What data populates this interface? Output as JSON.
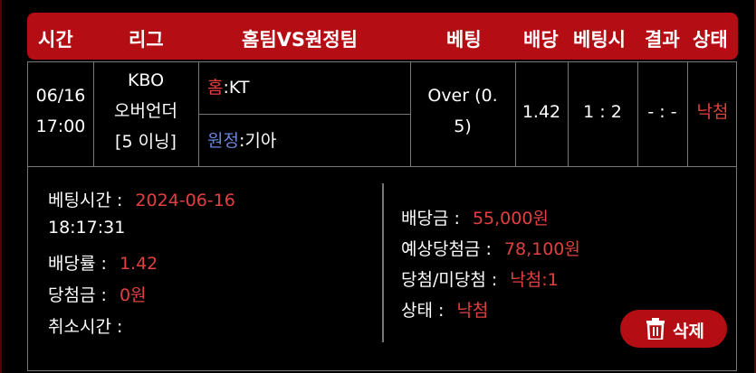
{
  "header": {
    "time": "시간",
    "league": "리그",
    "teams": "홈팀VS원정팀",
    "bet": "베팅",
    "odds": "배당",
    "bet_time": "베팅시",
    "result": "결과",
    "status": "상태"
  },
  "row": {
    "date": "06/16",
    "time": "17:00",
    "league_line1": "KBO",
    "league_line2": "오버언더",
    "league_line3": "[5 이닝]",
    "home_label": "홈",
    "home_team": ":KT",
    "away_label": "원정",
    "away_team": ":기아",
    "bet_line1": "Over (0.",
    "bet_line2": "5)",
    "odds": "1.42",
    "bet_score": "1 : 2",
    "result": "- : -",
    "status": "낙첨"
  },
  "details": {
    "bet_time_label": "베팅시간 :",
    "bet_time_date": "2024-06-16",
    "bet_time_clock": "18:17:31",
    "odds_rate_label": "배당률 :",
    "odds_rate_value": "1.42",
    "win_amount_label": "당첨금 :",
    "win_amount_value": "0원",
    "cancel_time_label": "취소시간 :",
    "stake_label": "배당금 :",
    "stake_value": "55,000원",
    "expected_label": "예상당첨금 :",
    "expected_value": "78,100원",
    "win_lose_label": "당첨/미당첨 :",
    "win_lose_value": "낙첨:1",
    "status_label": "상태 :",
    "status_value": "낙첨"
  },
  "delete_button": {
    "label": "삭제",
    "icon": "trash-icon"
  },
  "colors": {
    "accent": "#b50d14",
    "loss": "#e24040",
    "away": "#6a86d8"
  }
}
